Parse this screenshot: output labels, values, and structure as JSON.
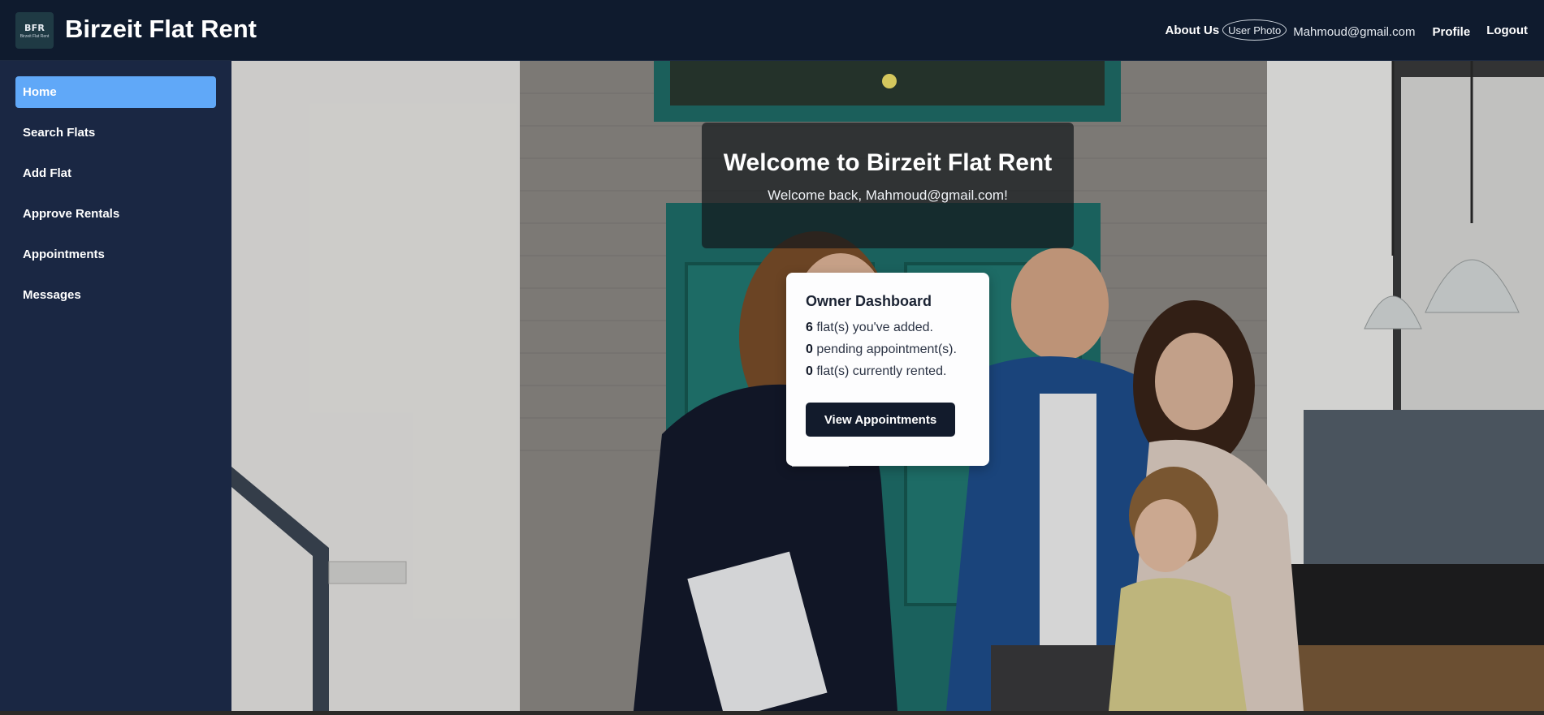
{
  "header": {
    "logo_mark": "BFR",
    "logo_sub": "Birzeit Flat Rent",
    "title": "Birzeit Flat Rent",
    "about_label": "About Us",
    "user_photo_alt": "User Photo",
    "user_email": "Mahmoud@gmail.com",
    "profile_label": "Profile",
    "logout_label": "Logout"
  },
  "sidebar": {
    "items": [
      {
        "label": "Home",
        "active": true
      },
      {
        "label": "Search Flats",
        "active": false
      },
      {
        "label": "Add Flat",
        "active": false
      },
      {
        "label": "Approve Rentals",
        "active": false
      },
      {
        "label": "Appointments",
        "active": false
      },
      {
        "label": "Messages",
        "active": false
      }
    ]
  },
  "welcome": {
    "title": "Welcome to Birzeit Flat Rent",
    "subtitle": "Welcome back, Mahmoud@gmail.com!"
  },
  "dashboard": {
    "title": "Owner Dashboard",
    "flats_added": "6",
    "flats_added_text": "flat(s) you've added.",
    "pending_appointments": "0",
    "pending_appointments_text": "pending appointment(s).",
    "flats_rented": "0",
    "flats_rented_text": "flat(s) currently rented.",
    "button_label": "View Appointments"
  },
  "colors": {
    "header_bg": "#0f1b2e",
    "sidebar_bg": "#1a2743",
    "active_item": "#60a8f8",
    "button_bg": "#121b2c"
  }
}
